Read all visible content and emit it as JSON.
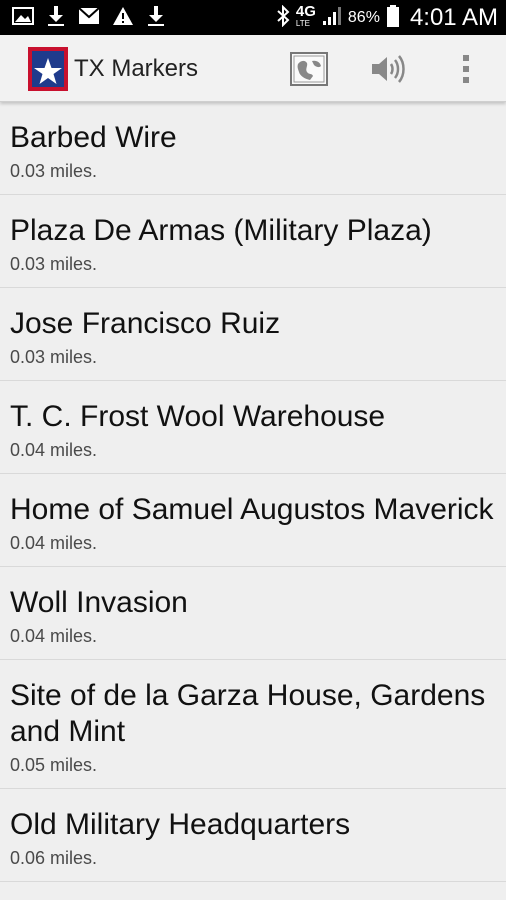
{
  "status_bar": {
    "battery_percent": "86%",
    "time": "4:01 AM",
    "network_label": "4G",
    "network_sub": "LTE",
    "icons": [
      "image-icon",
      "download-icon",
      "mail-icon",
      "warning-icon",
      "download-icon",
      "bluetooth-icon",
      "signal-icon",
      "battery-icon"
    ]
  },
  "action_bar": {
    "title": "TX Markers",
    "icons": [
      "texas-flag-icon",
      "map-icon",
      "volume-icon",
      "overflow-menu-icon"
    ],
    "colors": {
      "flag_blue": "#1f3b8c",
      "flag_red": "#c8102e"
    }
  },
  "markers": [
    {
      "title": "Barbed Wire",
      "distance": "0.03 miles."
    },
    {
      "title": "Plaza De Armas (Military Plaza)",
      "distance": "0.03 miles."
    },
    {
      "title": "Jose Francisco Ruiz",
      "distance": "0.03 miles."
    },
    {
      "title": "T. C. Frost Wool Warehouse",
      "distance": "0.04 miles."
    },
    {
      "title": "Home of Samuel Augustos Maverick",
      "distance": "0.04 miles."
    },
    {
      "title": "Woll Invasion",
      "distance": "0.04 miles."
    },
    {
      "title": "Site of de la Garza House, Gardens and Mint",
      "distance": "0.05 miles."
    },
    {
      "title": "Old Military Headquarters",
      "distance": "0.06 miles."
    }
  ]
}
